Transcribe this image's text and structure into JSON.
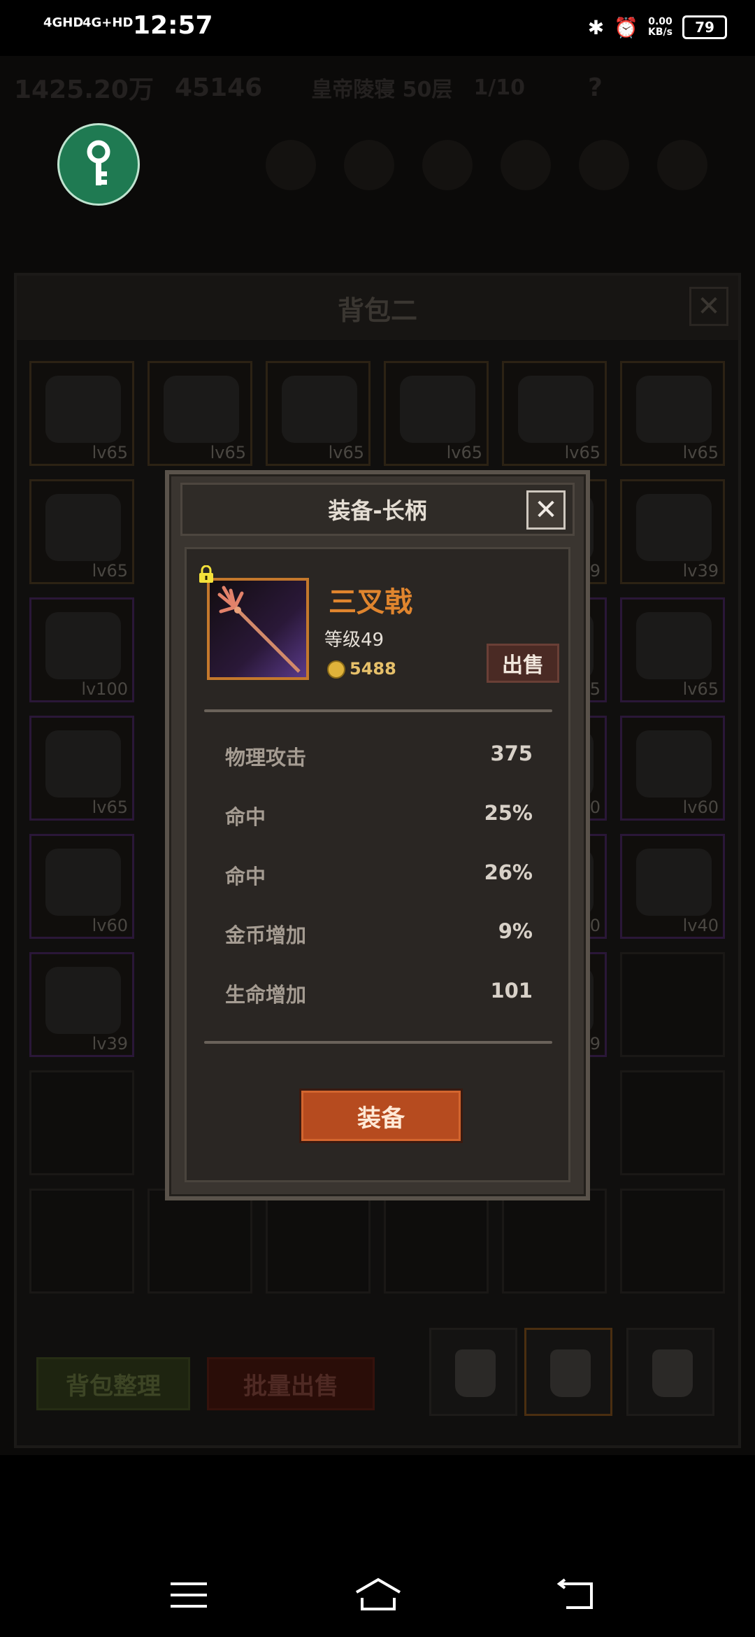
{
  "status_bar": {
    "network1": "4GHD",
    "network2": "4G+HD",
    "time": "12:57",
    "speed": "0.00",
    "speed_unit": "KB/s",
    "battery": "79"
  },
  "game_header": {
    "gold": "1425.20万",
    "gems": "45146",
    "location": "皇帝陵寝 50层",
    "keys": "1/10",
    "help": "?"
  },
  "backpack": {
    "title": "背包二",
    "close_label": "✕",
    "sort_button": "背包整理",
    "batch_sell_button": "批量出售",
    "slots_row1": [
      "lv65",
      "lv65",
      "lv65",
      "lv65",
      "lv65",
      "lv65"
    ],
    "slots_row2_left": "lv65",
    "slots_row2_right": "lv39",
    "slots_row2_hidden": "9",
    "slots_row3_left": "lv100",
    "slots_row3_right": "lv65",
    "slots_row3_hidden": "5",
    "slots_row4_left": "lv65",
    "slots_row4_right": "lv60",
    "slots_row4_hidden": "0",
    "slots_row5_left": "lv60",
    "slots_row5_right": "lv40",
    "slots_row5_hidden": "0",
    "slots_row6_left": "lv39",
    "slots_row6_hidden": "9"
  },
  "dialog": {
    "title": "装备-长柄",
    "close_label": "✕",
    "item_name": "三叉戟",
    "item_level": "等级49",
    "item_price": "5488",
    "sell_button": "出售",
    "stats": [
      {
        "name": "物理攻击",
        "value": "375"
      },
      {
        "name": "命中",
        "value": "25%"
      },
      {
        "name": "命中",
        "value": "26%"
      },
      {
        "name": "金币增加",
        "value": "9%"
      },
      {
        "name": "生命增加",
        "value": "101"
      }
    ],
    "equip_button": "装备"
  },
  "colors": {
    "item_name": "#e0852e",
    "equip_button": "#b64b1f",
    "rarity_orange": "#c4782c",
    "key_button": "#1f7a52"
  }
}
